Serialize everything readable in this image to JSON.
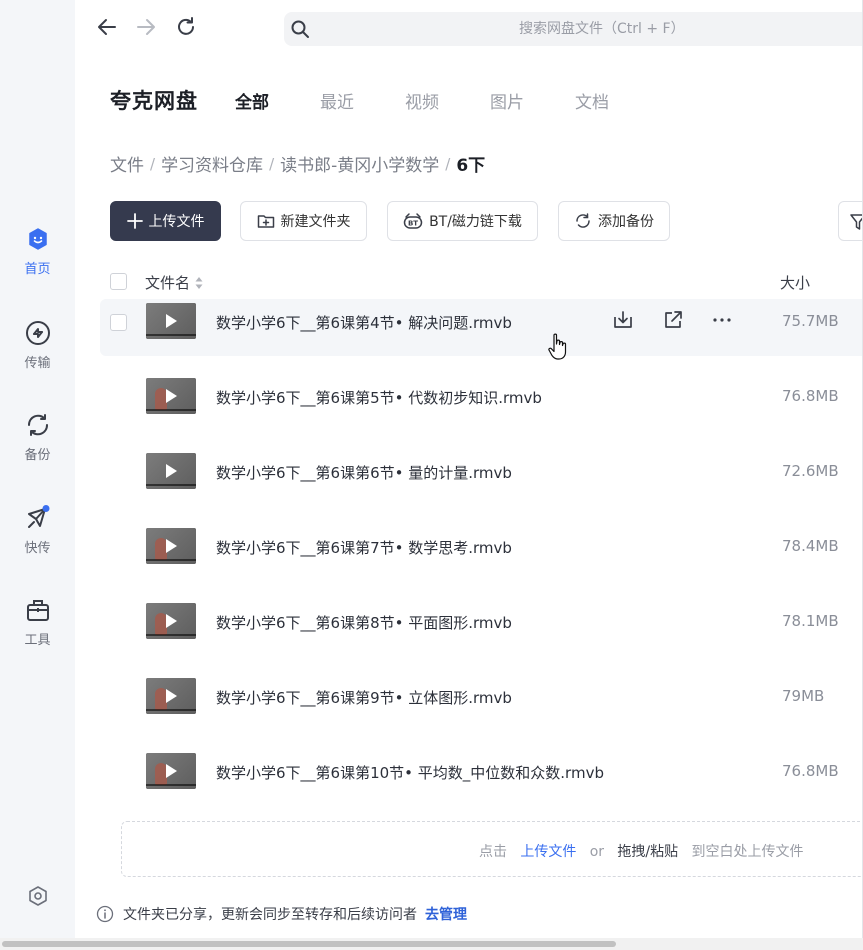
{
  "sidebar": {
    "items": [
      {
        "label": "首页",
        "icon": "home-face-icon"
      },
      {
        "label": "传输",
        "icon": "transfer-icon"
      },
      {
        "label": "备份",
        "icon": "backup-sync-icon"
      },
      {
        "label": "快传",
        "icon": "quick-send-icon"
      },
      {
        "label": "工具",
        "icon": "toolbox-icon"
      }
    ],
    "settings_icon": "settings-icon"
  },
  "search": {
    "placeholder": "搜索网盘文件（Ctrl + F）"
  },
  "header": {
    "brand": "夸克网盘",
    "tabs": [
      {
        "label": "全部",
        "active": true
      },
      {
        "label": "最近"
      },
      {
        "label": "视频"
      },
      {
        "label": "图片"
      },
      {
        "label": "文档"
      }
    ]
  },
  "breadcrumb": {
    "items": [
      "文件",
      "学习资料仓库",
      "读书郎-黄冈小学数学",
      "6下"
    ],
    "separator": "/"
  },
  "toolbar": {
    "upload_label": "上传文件",
    "new_folder_label": "新建文件夹",
    "bt_label": "BT/磁力链下载",
    "backup_label": "添加备份"
  },
  "table": {
    "col_name": "文件名",
    "col_size": "大小",
    "rows": [
      {
        "name": "数学小学6下__第6课第4节• 解决问题.rmvb",
        "size": "75.7MB"
      },
      {
        "name": "数学小学6下__第6课第5节• 代数初步知识.rmvb",
        "size": "76.8MB"
      },
      {
        "name": "数学小学6下__第6课第6节• 量的计量.rmvb",
        "size": "72.6MB"
      },
      {
        "name": "数学小学6下__第6课第7节• 数学思考.rmvb",
        "size": "78.4MB"
      },
      {
        "name": "数学小学6下__第6课第8节• 平面图形.rmvb",
        "size": "78.1MB"
      },
      {
        "name": "数学小学6下__第6课第9节• 立体图形.rmvb",
        "size": "79MB"
      },
      {
        "name": "数学小学6下__第6课第10节• 平均数_中位数和众数.rmvb",
        "size": "76.8MB"
      }
    ]
  },
  "dropzone": {
    "prefix": "点击",
    "upload_link": "上传文件",
    "or": "or",
    "drag": "拖拽/粘贴",
    "suffix": "到空白处上传文件"
  },
  "notice": {
    "text": "文件夹已分享，更新会同步至转存和后续访问者",
    "manage": "去管理"
  },
  "colors": {
    "accent": "#3a6ff0",
    "primary_button": "#353a4e",
    "sidebar_bg": "#f4f6f9"
  }
}
